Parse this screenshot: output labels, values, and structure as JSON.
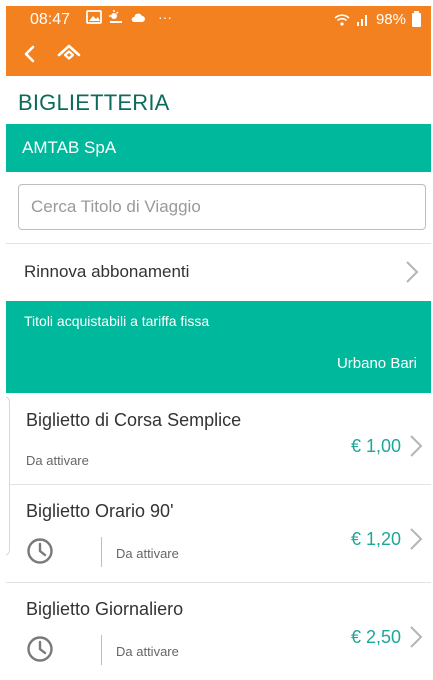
{
  "status_bar": {
    "time": "08:47",
    "notification_icons": [
      "image-icon",
      "weather-icon",
      "cloud-icon"
    ],
    "more": "···",
    "battery": "98%"
  },
  "header": {
    "title": "BIGLIETTERIA",
    "company": "AMTAB SpA",
    "accent_color": "#F4811F",
    "brand_color": "#00B89C"
  },
  "search": {
    "placeholder": "Cerca Titolo di Viaggio",
    "value": ""
  },
  "renew": {
    "label": "Rinnova abbonamenti"
  },
  "fixed_section": {
    "title": "Titoli acquistabili a tariffa fissa",
    "area": "Urbano Bari"
  },
  "tickets": [
    {
      "name": "Biglietto di Corsa Semplice",
      "status": "Da attivare",
      "price": "€ 1,00"
    },
    {
      "name": "Biglietto Orario 90'",
      "status": "Da attivare",
      "price": "€ 1,20"
    },
    {
      "name": "Biglietto Giornaliero",
      "status": "Da attivare",
      "price": "€ 2,50"
    }
  ]
}
